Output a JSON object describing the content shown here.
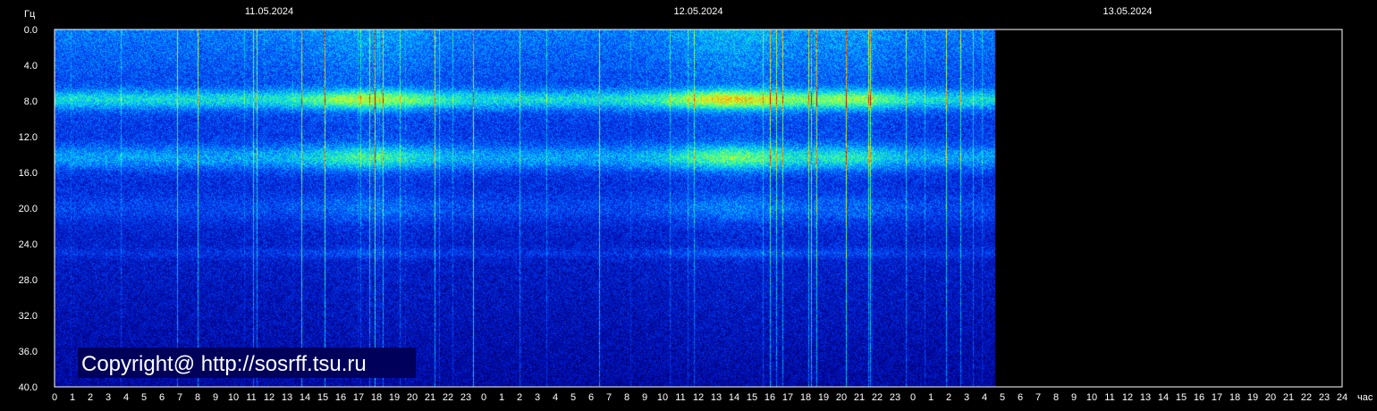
{
  "chart_data": {
    "type": "heatmap",
    "title": "",
    "ylabel": "Гц",
    "xlabel": "час",
    "ylim": [
      0,
      40
    ],
    "y_ticks": [
      "0.0",
      "4.0",
      "8.0",
      "12.0",
      "16.0",
      "20.0",
      "24.0",
      "28.0",
      "32.0",
      "36.0",
      "40.0"
    ],
    "x_range_hours": [
      0,
      72
    ],
    "data_end_hour": 52.6,
    "x_ticks": [
      "0",
      "1",
      "2",
      "3",
      "4",
      "5",
      "6",
      "7",
      "8",
      "9",
      "10",
      "11",
      "12",
      "13",
      "14",
      "15",
      "16",
      "17",
      "18",
      "19",
      "20",
      "21",
      "22",
      "23",
      "0",
      "1",
      "2",
      "3",
      "4",
      "5",
      "6",
      "7",
      "8",
      "9",
      "10",
      "11",
      "12",
      "13",
      "14",
      "15",
      "16",
      "17",
      "18",
      "19",
      "20",
      "21",
      "22",
      "23",
      "0",
      "1",
      "2",
      "3",
      "4",
      "5",
      "6",
      "7",
      "8",
      "9",
      "10",
      "11",
      "12",
      "13",
      "14",
      "15",
      "16",
      "17",
      "18",
      "19",
      "20",
      "21",
      "22",
      "23",
      "24"
    ],
    "dates": [
      {
        "label": "11.05.2024",
        "hour": 12
      },
      {
        "label": "12.05.2024",
        "hour": 36
      },
      {
        "label": "13.05.2024",
        "hour": 60
      }
    ],
    "resonance_bands_hz": [
      7.8,
      14.3,
      20.0,
      25.0
    ],
    "colorscale": [
      "#00007a",
      "#0018c8",
      "#0058ff",
      "#00c8ff",
      "#40ff90",
      "#e0ff20",
      "#ff7000",
      "#c00000"
    ],
    "colors": {
      "background": "#000000",
      "frame": "#ffffff",
      "no_data": "#000000"
    }
  },
  "copyright": "Copyright@ http://sosrff.tsu.ru"
}
